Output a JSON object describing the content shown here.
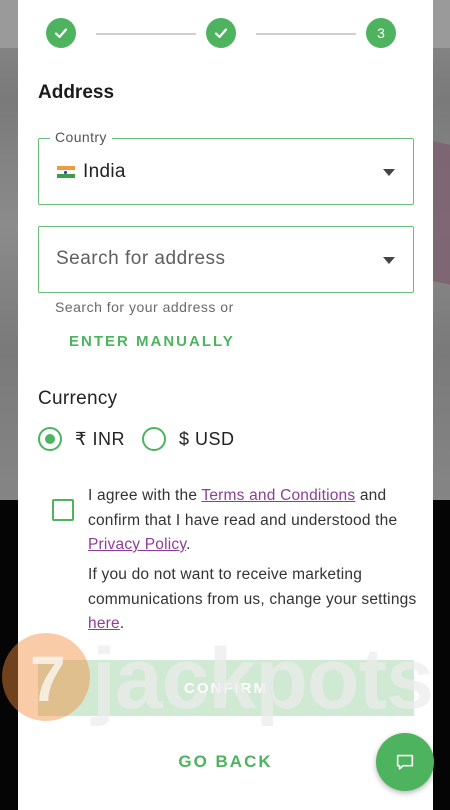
{
  "stepper": {
    "steps": [
      {
        "state": "done"
      },
      {
        "state": "done"
      },
      {
        "state": "current",
        "label": "3"
      }
    ]
  },
  "form": {
    "section_title": "Address",
    "country": {
      "legend": "Country",
      "value": "India",
      "flag": "india-flag-icon"
    },
    "address": {
      "placeholder": "Search for address",
      "helper": "Search for your address or",
      "manual_link": "ENTER MANUALLY"
    },
    "currency": {
      "title": "Currency",
      "options": [
        {
          "label": "₹ INR",
          "selected": true
        },
        {
          "label": "$ USD",
          "selected": false
        }
      ]
    },
    "terms": {
      "checked": false,
      "prefix": "I agree with the ",
      "terms_link": "Terms and Conditions",
      "middle": " and confirm that I have read and understood the ",
      "privacy_link": "Privacy Policy",
      "suffix": "."
    },
    "marketing": {
      "prefix": "If you do not want to receive marketing communications from us, change your settings ",
      "link": "here",
      "suffix": "."
    },
    "confirm_label": "CONFIRM",
    "go_back_label": "GO BACK"
  },
  "watermark": {
    "text": "jackpots",
    "numeral": "7"
  },
  "colors": {
    "accent": "#4db35e",
    "link": "#8e3d97",
    "confirm_disabled": "#cfe9d3"
  }
}
